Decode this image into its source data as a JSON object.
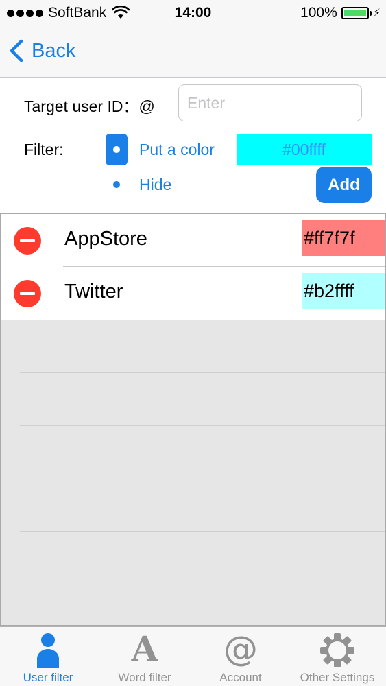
{
  "status_bar": {
    "carrier": "SoftBank",
    "time": "14:00",
    "battery_percent": "100%",
    "signal_dots": 4,
    "battery_level": 1.0
  },
  "nav": {
    "back_label": "Back"
  },
  "form": {
    "target_label": "Target user ID：@",
    "target_placeholder": "Enter",
    "target_value": "",
    "filter_label": "Filter:",
    "option_color_label": "Put a color",
    "option_color_value": "#00ffff",
    "option_hide_label": "Hide",
    "selected_option": "color",
    "add_label": "Add"
  },
  "list": {
    "rows": [
      {
        "name": "AppStore",
        "color": "#ff7f7f"
      },
      {
        "name": "Twitter",
        "color": "#b2ffff"
      }
    ]
  },
  "tab_bar": {
    "items": [
      {
        "label": "User filter",
        "icon": "person-icon",
        "active": true
      },
      {
        "label": "Word filter",
        "icon": "letter-a-icon",
        "active": false
      },
      {
        "label": "Account",
        "icon": "at-sign-icon",
        "active": false
      },
      {
        "label": "Other Settings",
        "icon": "gear-icon",
        "active": false
      }
    ]
  },
  "colors": {
    "accent": "#1a7fe6",
    "delete": "#ff3b30",
    "tab_inactive": "#929292",
    "battery": "#4cd964"
  }
}
